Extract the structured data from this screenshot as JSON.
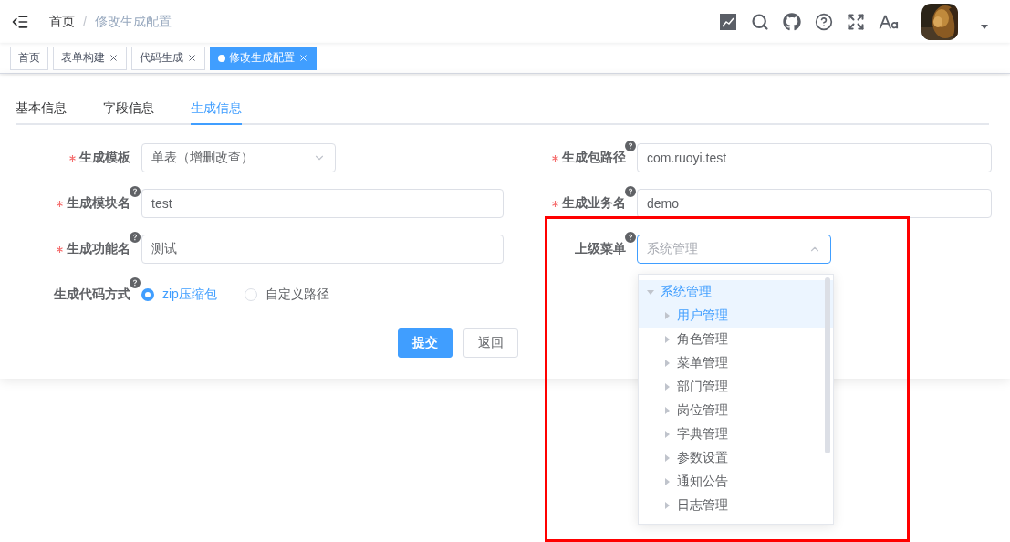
{
  "header": {
    "breadcrumb": [
      {
        "label": "首页",
        "current": false
      },
      {
        "label": "/",
        "kind": "separator"
      },
      {
        "label": "修改生成配置",
        "current": true
      }
    ]
  },
  "tags": [
    {
      "label": "首页",
      "selected": false,
      "closable": false
    },
    {
      "label": "表单构建",
      "selected": false,
      "closable": true
    },
    {
      "label": "代码生成",
      "selected": false,
      "closable": true
    },
    {
      "label": "修改生成配置",
      "selected": true,
      "closable": true
    }
  ],
  "form_tabs": [
    {
      "label": "基本信息",
      "selected": false
    },
    {
      "label": "字段信息",
      "selected": false
    },
    {
      "label": "生成信息",
      "selected": true
    }
  ],
  "fields": [
    {
      "kind": "select",
      "label": "生成模板",
      "required": true,
      "help": false,
      "value": "单表（增删改查）"
    },
    {
      "kind": "input",
      "label": "生成包路径",
      "required": true,
      "help": true,
      "value": "com.ruoyi.test"
    },
    {
      "kind": "input",
      "label": "生成模块名",
      "required": true,
      "help": true,
      "value": "test"
    },
    {
      "kind": "input",
      "label": "生成业务名",
      "required": true,
      "help": true,
      "value": "demo"
    },
    {
      "kind": "input",
      "label": "生成功能名",
      "required": true,
      "help": true,
      "value": "测试"
    },
    {
      "kind": "tree_select",
      "label": "上级菜单",
      "required": false,
      "help": true,
      "placeholder": "系统管理",
      "expanded": true,
      "nodes": [
        {
          "label": "系统管理",
          "highlighted": true,
          "expanded": true,
          "children": [
            {
              "label": "用户管理",
              "highlighted": true,
              "expanded": false
            },
            {
              "label": "角色管理",
              "highlighted": false,
              "expanded": false
            },
            {
              "label": "菜单管理",
              "highlighted": false,
              "expanded": false
            },
            {
              "label": "部门管理",
              "highlighted": false,
              "expanded": false
            },
            {
              "label": "岗位管理",
              "highlighted": false,
              "expanded": false
            },
            {
              "label": "字典管理",
              "highlighted": false,
              "expanded": false
            },
            {
              "label": "参数设置",
              "highlighted": false,
              "expanded": false
            },
            {
              "label": "通知公告",
              "highlighted": false,
              "expanded": false
            },
            {
              "label": "日志管理",
              "highlighted": false,
              "expanded": false
            }
          ]
        }
      ]
    },
    {
      "kind": "radio",
      "label": "生成代码方式",
      "required": false,
      "help": true,
      "options": [
        {
          "label": "zip压缩包",
          "selected": true
        },
        {
          "label": "自定义路径",
          "selected": false
        }
      ]
    }
  ],
  "buttons": [
    {
      "label": "提交",
      "kind": "primary"
    },
    {
      "label": "返回",
      "kind": "default"
    }
  ],
  "annotation": {
    "kind": "box",
    "color": "#ff0000"
  }
}
